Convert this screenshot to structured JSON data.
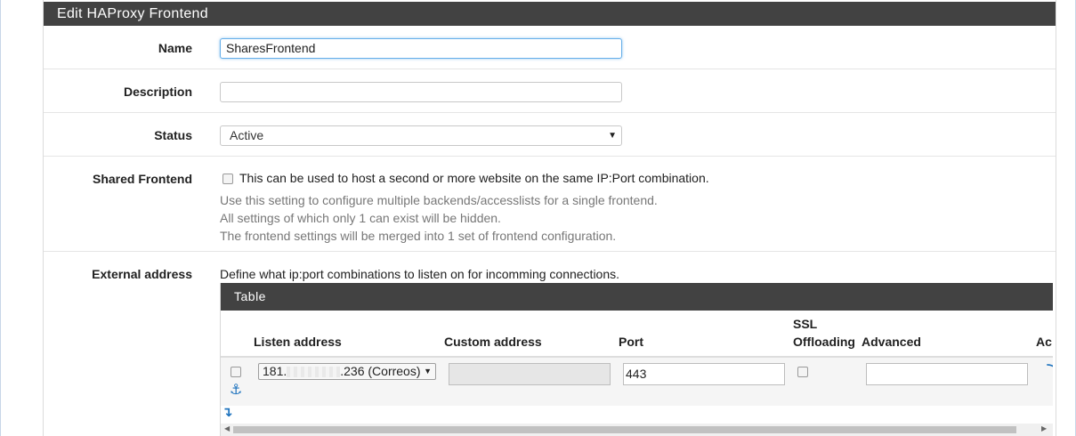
{
  "panel": {
    "title": "Edit HAProxy Frontend"
  },
  "fields": {
    "name": {
      "label": "Name",
      "value": "SharesFrontend"
    },
    "description": {
      "label": "Description",
      "value": ""
    },
    "status": {
      "label": "Status",
      "selected": "Active"
    },
    "shared_frontend": {
      "label": "Shared Frontend",
      "checkbox_text": "This can be used to host a second or more website on the same IP:Port combination.",
      "help": [
        "Use this setting to configure multiple backends/accesslists for a single frontend.",
        "All settings of which only 1 can exist will be hidden.",
        "The frontend settings will be merged into 1 set of frontend configuration."
      ]
    },
    "external_address": {
      "label": "External address",
      "description": "Define what ip:port combinations to listen on for incomming connections."
    }
  },
  "table": {
    "title": "Table",
    "columns": {
      "listen_address": "Listen address",
      "custom_address": "Custom address",
      "port": "Port",
      "ssl_line1": "SSL",
      "ssl_line2": "Offloading",
      "advanced": "Advanced",
      "action": "Ac"
    },
    "row": {
      "listen_prefix": "181.",
      "listen_suffix": ".236 (Correos)",
      "custom_address": "",
      "port": "443",
      "advanced": ""
    }
  },
  "colors": {
    "heading_bg": "#424242",
    "accent": "#1e73be",
    "focus": "#66afe9"
  }
}
